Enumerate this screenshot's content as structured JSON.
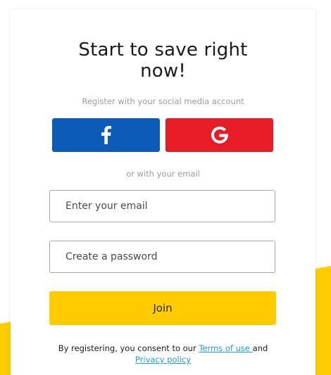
{
  "colors": {
    "accent_yellow": "#ffcc00",
    "facebook_blue": "#0a5cb8",
    "google_red": "#e81c27",
    "link_blue": "#1e9fd8"
  },
  "signup": {
    "title_line1": "Start to save right",
    "title_line2": "now!",
    "social_caption": "Register with your social media account",
    "facebook_icon": "facebook-f-icon",
    "google_icon": "google-g-icon",
    "email_caption": "or with your email",
    "email_placeholder": "Enter your email",
    "password_placeholder": "Create a password",
    "join_label": "Join",
    "consent_text": "By registering, you consent to our ",
    "terms_link": "Terms of use ",
    "consent_and": "and",
    "privacy_link": "Privacy policy"
  }
}
